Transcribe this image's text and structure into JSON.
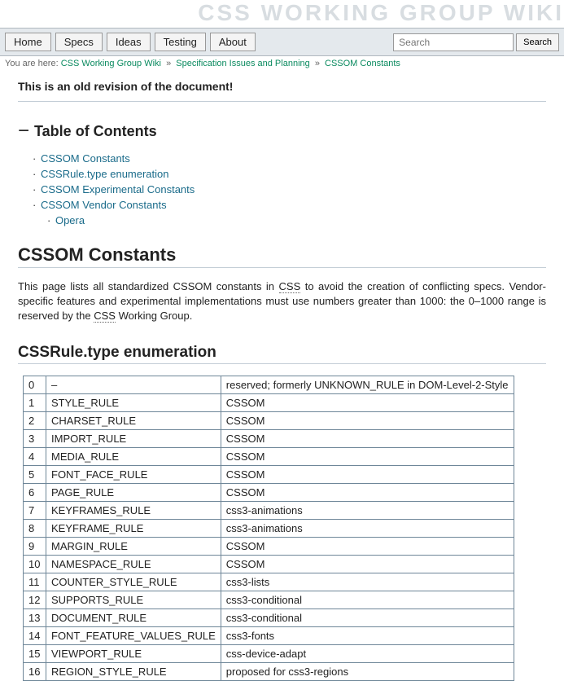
{
  "site_title": "CSS WORKING GROUP WIKI",
  "nav": {
    "items": [
      "Home",
      "Specs",
      "Ideas",
      "Testing",
      "About"
    ]
  },
  "search": {
    "placeholder": "Search",
    "button": "Search"
  },
  "breadcrumb": {
    "prefix": "You are here:",
    "items": [
      "CSS Working Group Wiki",
      "Specification Issues and Planning",
      "CSSOM Constants"
    ],
    "sep": "»"
  },
  "old_revision": "This is an old revision of the document!",
  "toc": {
    "toggle": "−",
    "heading": "Table of Contents",
    "items": [
      {
        "label": "CSSOM Constants"
      },
      {
        "label": "CSSRule.type enumeration"
      },
      {
        "label": "CSSOM Experimental Constants"
      },
      {
        "label": "CSSOM Vendor Constants",
        "children": [
          {
            "label": "Opera"
          }
        ]
      }
    ]
  },
  "h1": "CSSOM Constants",
  "intro": {
    "p1a": "This page lists all standardized CSSOM constants in ",
    "abbr1": "CSS",
    "p1b": " to avoid the creation of conflicting specs. Vendor-specific features and experimental implementations must use numbers greater than 1000: the 0–1000 range is reserved by the ",
    "abbr2": "CSS",
    "p1c": " Working Group."
  },
  "h2": "CSSRule.type enumeration",
  "table": {
    "rows": [
      [
        "0",
        "–",
        "reserved; formerly UNKNOWN_RULE in DOM-Level-2-Style"
      ],
      [
        "1",
        "STYLE_RULE",
        "CSSOM"
      ],
      [
        "2",
        "CHARSET_RULE",
        "CSSOM"
      ],
      [
        "3",
        "IMPORT_RULE",
        "CSSOM"
      ],
      [
        "4",
        "MEDIA_RULE",
        "CSSOM"
      ],
      [
        "5",
        "FONT_FACE_RULE",
        "CSSOM"
      ],
      [
        "6",
        "PAGE_RULE",
        "CSSOM"
      ],
      [
        "7",
        "KEYFRAMES_RULE",
        "css3-animations"
      ],
      [
        "8",
        "KEYFRAME_RULE",
        "css3-animations"
      ],
      [
        "9",
        "MARGIN_RULE",
        "CSSOM"
      ],
      [
        "10",
        "NAMESPACE_RULE",
        "CSSOM"
      ],
      [
        "11",
        "COUNTER_STYLE_RULE",
        "css3-lists"
      ],
      [
        "12",
        "SUPPORTS_RULE",
        "css3-conditional"
      ],
      [
        "13",
        "DOCUMENT_RULE",
        "css3-conditional"
      ],
      [
        "14",
        "FONT_FEATURE_VALUES_RULE",
        "css3-fonts"
      ],
      [
        "15",
        "VIEWPORT_RULE",
        "css-device-adapt"
      ],
      [
        "16",
        "REGION_STYLE_RULE",
        "proposed for css3-regions"
      ]
    ]
  }
}
